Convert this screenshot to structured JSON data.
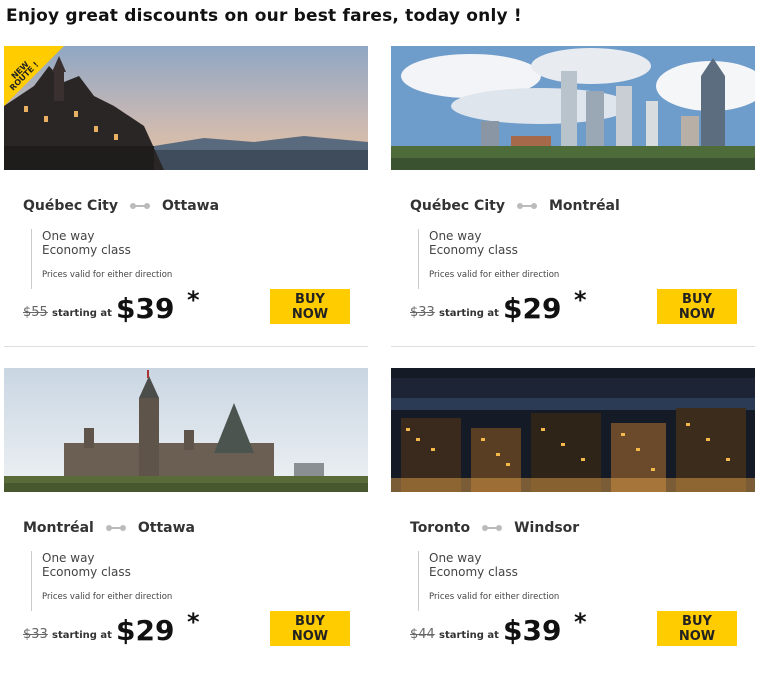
{
  "headline": "Enjoy great discounts on our best fares, today only !",
  "fare_note": "Prices valid for either direction",
  "buy_label": "BUY NOW",
  "starting_label": "starting at",
  "asterisk": "*",
  "colors": {
    "button": "#ffcc00",
    "banner": "#ffcc00"
  },
  "cards": [
    {
      "from": "Québec City",
      "to": "Ottawa",
      "trip": "One way",
      "class": "Economy class",
      "old_price": "$55",
      "price": "$39",
      "banner": "NEW ROUTE !",
      "photo": "quebec-city-chateau-photo"
    },
    {
      "from": "Québec City",
      "to": "Montréal",
      "trip": "One way",
      "class": "Economy class",
      "old_price": "$33",
      "price": "$29",
      "photo": "montreal-skyline-photo"
    },
    {
      "from": "Montréal",
      "to": "Ottawa",
      "trip": "One way",
      "class": "Economy class",
      "old_price": "$33",
      "price": "$29",
      "photo": "ottawa-parliament-photo"
    },
    {
      "from": "Toronto",
      "to": "Windsor",
      "trip": "One way",
      "class": "Economy class",
      "old_price": "$44",
      "price": "$39",
      "photo": "windsor-night-city-photo"
    }
  ]
}
